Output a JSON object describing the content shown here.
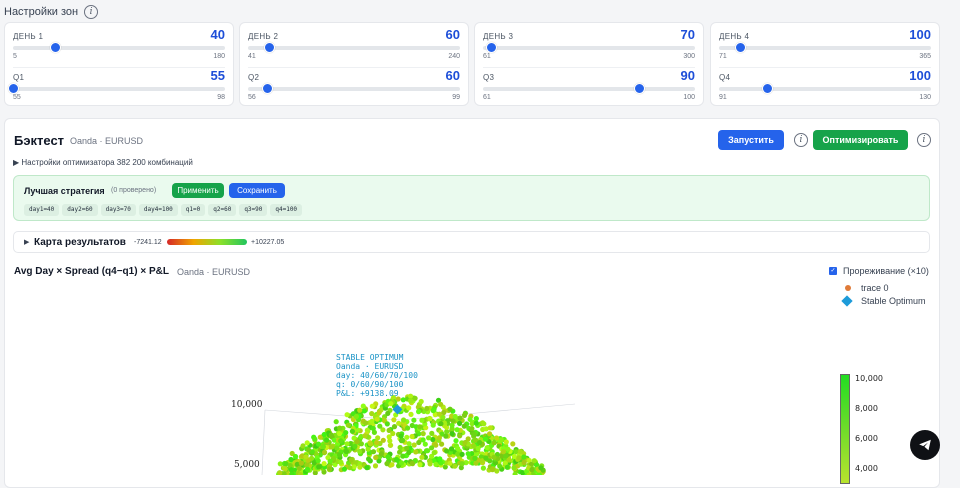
{
  "zones": {
    "title": "Настройки зон",
    "info_icon": "i",
    "cards": [
      {
        "day_label": "ДЕНЬ 1",
        "day_value": "40",
        "day_min": "5",
        "day_max": "180",
        "day_fraction": 0.2,
        "q_label": "Q1",
        "q_value": "55",
        "q_min": "55",
        "q_max": "98",
        "q_fraction": 0.0
      },
      {
        "day_label": "ДЕНЬ 2",
        "day_value": "60",
        "day_min": "41",
        "day_max": "240",
        "day_fraction": 0.1,
        "q_label": "Q2",
        "q_value": "60",
        "q_min": "56",
        "q_max": "99",
        "q_fraction": 0.09
      },
      {
        "day_label": "ДЕНЬ 3",
        "day_value": "70",
        "day_min": "61",
        "day_max": "300",
        "day_fraction": 0.04,
        "q_label": "Q3",
        "q_value": "90",
        "q_min": "61",
        "q_max": "100",
        "q_fraction": 0.74
      },
      {
        "day_label": "ДЕНЬ 4",
        "day_value": "100",
        "day_min": "71",
        "day_max": "365",
        "day_fraction": 0.1,
        "q_label": "Q4",
        "q_value": "100",
        "q_min": "91",
        "q_max": "130",
        "q_fraction": 0.23
      }
    ]
  },
  "backtest": {
    "title": "Бэктест",
    "subtitle": "Oanda · EURUSD",
    "run_label": "Запустить",
    "optimize_label": "Оптимизировать",
    "optimizer_settings": "▶ Настройки оптимизатора   382 200 комбинаций",
    "best": {
      "title": "Лучшая стратегия",
      "count": "(0 проверено)",
      "apply_label": "Применить",
      "save_label": "Сохранить",
      "chips": [
        "day1=40",
        "day2=60",
        "day3=70",
        "day4=100",
        "q1=0",
        "q2=60",
        "q3=90",
        "q4=100"
      ]
    },
    "results": {
      "arrow": "▶",
      "title": "Карта результатов",
      "min": "-7241.12",
      "max": "+10227.05"
    },
    "plot": {
      "title": "Avg Day × Spread (q4−q1) × P&L",
      "subtitle": "Oanda · EURUSD",
      "thinning_label": "Прореживание (×10)",
      "legend": [
        "trace 0",
        "Stable Optimum"
      ],
      "annotation": [
        "STABLE OPTIMUM",
        "Oanda · EURUSD",
        "day: 40/60/70/100",
        "q: 0/60/90/100",
        "P&L: +9138.09"
      ],
      "y_ticks": [
        "10,000",
        "5,000"
      ],
      "colorbar_ticks": [
        "10,000",
        "8,000",
        "6,000",
        "4,000"
      ]
    }
  },
  "colors": {
    "primary": "#2563eb",
    "success": "#16a34a",
    "background": "#f4f5f7"
  }
}
